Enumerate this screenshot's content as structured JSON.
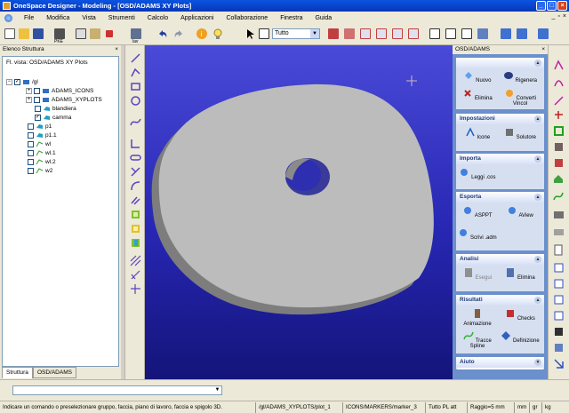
{
  "window": {
    "title": "OneSpace Designer - Modeling - [OSD/ADAMS XY Plots]"
  },
  "menu": [
    "File",
    "Modifica",
    "Vista",
    "Strumenti",
    "Calcolo",
    "Applicazioni",
    "Collaborazione",
    "Finestra",
    "Guida"
  ],
  "toolbar": {
    "filter_value": "Tutto",
    "labels": {
      "lav": "lav",
      "pke": "PKE"
    }
  },
  "structure": {
    "title": "Elenco Struttura",
    "vista": "Fl. vista: OSD/ADAMS XY Plots",
    "items": [
      {
        "label": "/gl"
      },
      {
        "label": "ADAMS_ICONS"
      },
      {
        "label": "ADAMS_XYPLOTS"
      },
      {
        "label": "blandiera"
      },
      {
        "label": "camma"
      },
      {
        "label": "p1"
      },
      {
        "label": "p1.1"
      },
      {
        "label": "wl"
      },
      {
        "label": "wl.1"
      },
      {
        "label": "wl.2"
      },
      {
        "label": "w2"
      }
    ],
    "tabs": [
      "Struttura",
      "OSD/ADAMS"
    ]
  },
  "right_panel": {
    "title": "OSD/ADAMS",
    "groups": [
      {
        "title": "",
        "buttons": [
          "Nuovo",
          "Rigenera",
          "Elimina",
          "Converti Vincol"
        ]
      },
      {
        "title": "Impostazioni",
        "buttons": [
          "Icone",
          "Solutore"
        ]
      },
      {
        "title": "Importa",
        "buttons": [
          "Leggi .cos"
        ]
      },
      {
        "title": "Esporta",
        "buttons": [
          "ASPPT",
          "AView",
          "Scrivi .adm"
        ]
      },
      {
        "title": "Analisi",
        "buttons": [
          "Esegui",
          "Elimina"
        ]
      },
      {
        "title": "Risultati",
        "buttons": [
          "Animazione",
          "Checks",
          "Tracce Spline",
          "Definizione"
        ]
      },
      {
        "title": "Aiuto",
        "buttons": []
      }
    ]
  },
  "status": {
    "prompt": "Indicare un comando o preselezionare gruppo, faccia, piano di lavoro, faccia e spigolo 3D.",
    "path1": "/gl/ADAMS_XYPLOTS/plot_1",
    "path2": "ICONS/MARKERS/marker_3",
    "mode": "Tutto PL att",
    "raggio": "Raggio=5 mm",
    "units": [
      "mm",
      "gr",
      "kg"
    ]
  },
  "colors": {
    "viewport_top": "#4a4ad8",
    "viewport_bottom": "#14147a",
    "part": "#b8b8b8",
    "panel": "#6b90cc",
    "titlebar": "#0a54e0"
  }
}
